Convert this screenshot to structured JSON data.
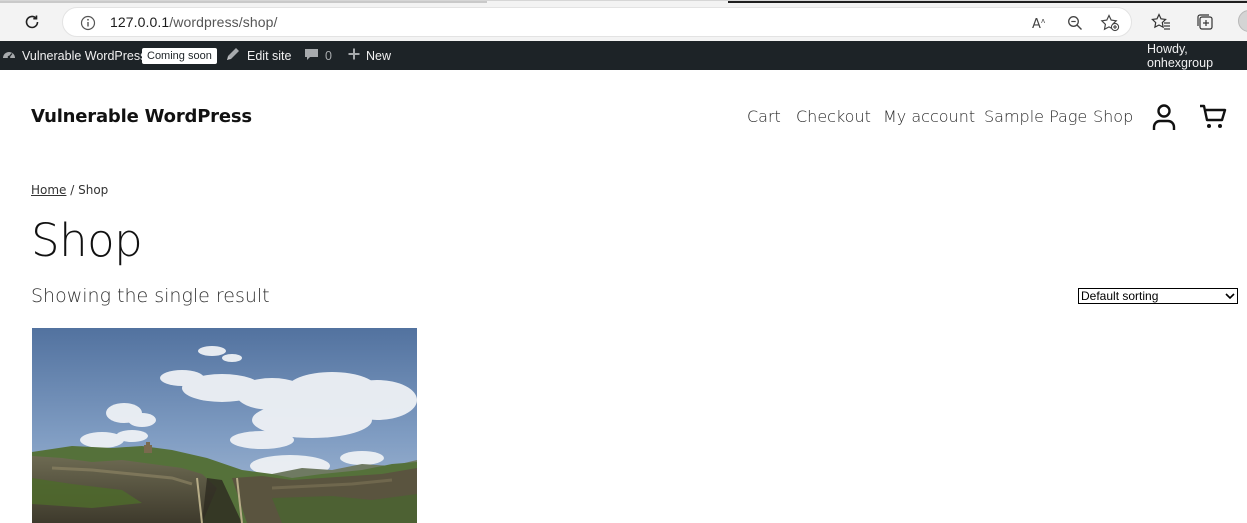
{
  "browser": {
    "url_host": "127.0.0.1",
    "url_path": "/wordpress/shop/",
    "icons": [
      "reload-icon",
      "info-icon",
      "read-aloud-icon",
      "zoom-icon",
      "add-favorite-icon",
      "favorites-icon",
      "collections-icon"
    ]
  },
  "admin_bar": {
    "site_name": "Vulnerable WordPress",
    "coming_soon": "Coming soon",
    "edit_site": "Edit site",
    "comments_count": "0",
    "new_label": "New",
    "howdy": "Howdy, onhexgroup"
  },
  "site": {
    "title": "Vulnerable WordPress",
    "nav": [
      "Cart",
      "Checkout",
      "My account",
      "Sample Page",
      "Shop"
    ]
  },
  "content": {
    "breadcrumb_home": "Home",
    "breadcrumb_separator": " / ",
    "breadcrumb_current": "Shop",
    "page_title": "Shop",
    "result_count": "Showing the single result",
    "sorting_selected": "Default sorting"
  },
  "colors": {
    "admin_bar_bg": "#1d2327",
    "sky": "#5b7fb8",
    "grass": "#4d6a2c"
  }
}
